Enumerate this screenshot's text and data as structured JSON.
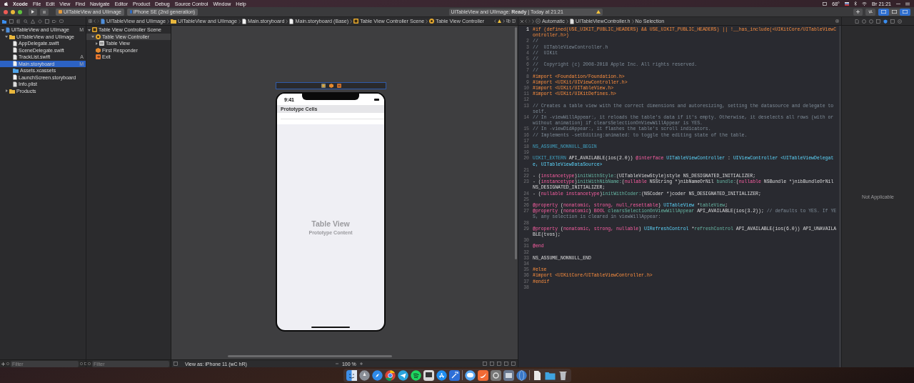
{
  "menu_bar": {
    "app": "Xcode",
    "menus": [
      "File",
      "Edit",
      "View",
      "Find",
      "Navigate",
      "Editor",
      "Product",
      "Debug",
      "Source Control",
      "Window",
      "Help"
    ],
    "temperature": "68°",
    "clock": "Вт 21:21"
  },
  "toolbar": {
    "scheme": "UITableView and UIImage",
    "device": "iPhone SE (2nd generation)",
    "activity": "UITableView and UIImage: **Ready** | Today at 21:21"
  },
  "navigator": {
    "items": [
      {
        "label": "UITableView and UIImage",
        "kind": "project",
        "status": "M",
        "selected": false,
        "expanded": true,
        "children": [
          {
            "label": "UITableView and UIImage",
            "kind": "folder",
            "selected": false,
            "expanded": true,
            "children": [
              {
                "label": "AppDelegate.swift",
                "kind": "swift",
                "selected": false
              },
              {
                "label": "SceneDelegate.swift",
                "kind": "swift",
                "selected": false
              },
              {
                "label": "TrackList.swift",
                "kind": "swift",
                "status": "A",
                "selected": false
              },
              {
                "label": "Main.storyboard",
                "kind": "storyboard",
                "status": "M",
                "selected": true
              },
              {
                "label": "Assets.xcassets",
                "kind": "assets",
                "selected": false
              },
              {
                "label": "LaunchScreen.storyboard",
                "kind": "storyboard",
                "selected": false
              },
              {
                "label": "Info.plist",
                "kind": "plist",
                "selected": false
              }
            ]
          },
          {
            "label": "Products",
            "kind": "folder",
            "selected": false,
            "expanded": false
          }
        ]
      }
    ],
    "filter": {
      "placeholder": "Filter"
    }
  },
  "storyboard_jump_bar": [
    {
      "label": "UITableView and UIImage",
      "kind": "project"
    },
    {
      "label": "UITableView and UIImage",
      "kind": "folder"
    },
    {
      "label": "Main.storyboard",
      "kind": "storyboard"
    },
    {
      "label": "Main.storyboard (Base)",
      "kind": "storyboard"
    },
    {
      "label": "Table View Controller Scene",
      "kind": "scene"
    },
    {
      "label": "Table View Controller",
      "kind": "controller"
    }
  ],
  "outline": {
    "items": [
      {
        "label": "Table View Controller Scene",
        "kind": "scene",
        "selected": false,
        "expanded": true,
        "children": [
          {
            "label": "Table View Controller",
            "kind": "controller",
            "selected": true,
            "expanded": true,
            "children": [
              {
                "label": "Table View",
                "kind": "tableview",
                "selected": false,
                "expanded": false
              }
            ]
          },
          {
            "label": "First Responder",
            "kind": "responder",
            "selected": false
          },
          {
            "label": "Exit",
            "kind": "exit",
            "selected": false
          }
        ]
      }
    ],
    "filter": {
      "placeholder": "Filter"
    }
  },
  "canvas": {
    "status_time": "9:41",
    "section_header": "Prototype Cells",
    "placeholder_title": "Table View",
    "placeholder_subtitle": "Prototype Content",
    "view_as": "View as: iPhone 11 (wC hR)",
    "zoom": "100 %"
  },
  "editor": {
    "jump_bar": [
      {
        "label": "Automatic",
        "kind": "automatic"
      },
      {
        "label": "UITableViewController.h",
        "kind": "header"
      },
      {
        "label": "No Selection",
        "kind": "none"
      }
    ],
    "lines": [
      {
        "number": "1",
        "segments": [
          {
            "text": "#if (defined(USE_UIKIT_PUBLIC_HEADERS) && USE_UIKIT_PUBLIC_HEADERS) || !__has_include(<UIKitCore/UITableViewController.h>)",
            "kind": "preproc"
          }
        ]
      },
      {
        "number": "2",
        "segments": [
          {
            "text": "//",
            "kind": "comment"
          }
        ]
      },
      {
        "number": "3",
        "segments": [
          {
            "text": "//  UITableViewController.h",
            "kind": "comment"
          }
        ]
      },
      {
        "number": "4",
        "segments": [
          {
            "text": "//  UIKit",
            "kind": "comment"
          }
        ]
      },
      {
        "number": "5",
        "segments": [
          {
            "text": "//",
            "kind": "comment"
          }
        ]
      },
      {
        "number": "6",
        "segments": [
          {
            "text": "//  Copyright (c) 2008-2018 Apple Inc. All rights reserved.",
            "kind": "comment"
          }
        ]
      },
      {
        "number": "7",
        "segments": [
          {
            "text": "//",
            "kind": "comment"
          }
        ]
      },
      {
        "number": "8",
        "segments": [
          {
            "text": "#import <Foundation/Foundation.h>",
            "kind": "preproc"
          }
        ]
      },
      {
        "number": "9",
        "segments": [
          {
            "text": "#import <UIKit/UIViewController.h>",
            "kind": "preproc"
          }
        ]
      },
      {
        "number": "10",
        "segments": [
          {
            "text": "#import <UIKit/UITableView.h>",
            "kind": "preproc"
          }
        ]
      },
      {
        "number": "11",
        "segments": [
          {
            "text": "#import <UIKit/UIKitDefines.h>",
            "kind": "preproc"
          }
        ]
      },
      {
        "number": "12"
      },
      {
        "number": "13",
        "segments": [
          {
            "text": "// Creates a table view with the correct dimensions and autoresizing, setting the datasource and delegate to self.",
            "kind": "comment"
          }
        ]
      },
      {
        "number": "14",
        "segments": [
          {
            "text": "// In -viewWillAppear:, it reloads the table's data if it's empty. Otherwise, it deselects all rows (with or without animation) if clearsSelectionOnViewWillAppear is YES.",
            "kind": "comment"
          }
        ]
      },
      {
        "number": "15",
        "segments": [
          {
            "text": "// In -viewDidAppear:, it flashes the table's scroll indicators.",
            "kind": "comment"
          }
        ]
      },
      {
        "number": "16",
        "segments": [
          {
            "text": "// Implements -setEditing:animated: to toggle the editing state of the table.",
            "kind": "comment"
          }
        ]
      },
      {
        "number": "17"
      },
      {
        "number": "18",
        "segments": [
          {
            "text": "NS_ASSUME_NONNULL_BEGIN",
            "kind": "macro"
          }
        ]
      },
      {
        "number": "19"
      },
      {
        "number": "20",
        "segments": [
          {
            "text": "UIKIT_EXTERN",
            "kind": "macro"
          },
          {
            "text": " API_AVAILABLE(ios(2.0)) ",
            "kind": "plain"
          },
          {
            "text": "@interface",
            "kind": "keyword"
          },
          {
            "text": " UITableViewController",
            "kind": "type"
          },
          {
            "text": " : ",
            "kind": "plain"
          },
          {
            "text": "UIViewController",
            "kind": "type"
          },
          {
            "text": " <UITableViewDelegate, UITableViewDataSource>",
            "kind": "type"
          }
        ]
      },
      {
        "number": "21"
      },
      {
        "number": "22",
        "segments": [
          {
            "text": "- (",
            "kind": "plain"
          },
          {
            "text": "instancetype",
            "kind": "keyword"
          },
          {
            "text": ")",
            "kind": "plain"
          },
          {
            "text": "initWithStyle:",
            "kind": "method"
          },
          {
            "text": "(UITableViewStyle)style NS_DESIGNATED_INITIALIZER;",
            "kind": "plain"
          }
        ]
      },
      {
        "number": "23",
        "segments": [
          {
            "text": "- (",
            "kind": "plain"
          },
          {
            "text": "instancetype",
            "kind": "keyword"
          },
          {
            "text": ")",
            "kind": "plain"
          },
          {
            "text": "initWithNibName:",
            "kind": "method"
          },
          {
            "text": "(",
            "kind": "plain"
          },
          {
            "text": "nullable",
            "kind": "keyword"
          },
          {
            "text": " NSString *)nibNameOrNil ",
            "kind": "plain"
          },
          {
            "text": "bundle:",
            "kind": "method"
          },
          {
            "text": "(",
            "kind": "plain"
          },
          {
            "text": "nullable",
            "kind": "keyword"
          },
          {
            "text": " NSBundle *)nibBundleOrNil NS_DESIGNATED_INITIALIZER;",
            "kind": "plain"
          }
        ]
      },
      {
        "number": "24",
        "segments": [
          {
            "text": "- (",
            "kind": "plain"
          },
          {
            "text": "nullable instancetype",
            "kind": "keyword"
          },
          {
            "text": ")",
            "kind": "plain"
          },
          {
            "text": "initWithCoder:",
            "kind": "method"
          },
          {
            "text": "(NSCoder *)coder NS_DESIGNATED_INITIALIZER;",
            "kind": "plain"
          }
        ]
      },
      {
        "number": "25"
      },
      {
        "number": "26",
        "segments": [
          {
            "text": "@property",
            "kind": "keyword"
          },
          {
            "text": " (",
            "kind": "plain"
          },
          {
            "text": "nonatomic, strong, null_resettable",
            "kind": "keyword"
          },
          {
            "text": ") ",
            "kind": "plain"
          },
          {
            "text": "UITableView",
            "kind": "type"
          },
          {
            "text": " *",
            "kind": "plain"
          },
          {
            "text": "tableView",
            "kind": "method"
          },
          {
            "text": ";",
            "kind": "plain"
          }
        ]
      },
      {
        "number": "27",
        "segments": [
          {
            "text": "@property",
            "kind": "keyword"
          },
          {
            "text": " (",
            "kind": "plain"
          },
          {
            "text": "nonatomic",
            "kind": "keyword"
          },
          {
            "text": ") ",
            "kind": "plain"
          },
          {
            "text": "BOOL",
            "kind": "keyword"
          },
          {
            "text": " clearsSelectionOnViewWillAppear",
            "kind": "method"
          },
          {
            "text": " API_AVAILABLE(ios(3.2)); ",
            "kind": "plain"
          },
          {
            "text": "// defaults to YES. If YES, any selection is cleared in viewWillAppear:",
            "kind": "comment"
          }
        ]
      },
      {
        "number": "28"
      },
      {
        "number": "29",
        "segments": [
          {
            "text": "@property",
            "kind": "keyword"
          },
          {
            "text": " (",
            "kind": "plain"
          },
          {
            "text": "nonatomic, strong, nullable",
            "kind": "keyword"
          },
          {
            "text": ") ",
            "kind": "plain"
          },
          {
            "text": "UIRefreshControl",
            "kind": "type"
          },
          {
            "text": " *",
            "kind": "plain"
          },
          {
            "text": "refreshControl",
            "kind": "method"
          },
          {
            "text": " API_AVAILABLE(ios(6.0)) API_UNAVAILABLE(tvos);",
            "kind": "plain"
          }
        ]
      },
      {
        "number": "30"
      },
      {
        "number": "31",
        "segments": [
          {
            "text": "@end",
            "kind": "keyword"
          }
        ]
      },
      {
        "number": "32"
      },
      {
        "number": "33",
        "segments": [
          {
            "text": "NS_ASSUME_NONNULL_END",
            "kind": "plain"
          }
        ]
      },
      {
        "number": "34"
      },
      {
        "number": "35",
        "segments": [
          {
            "text": "#else",
            "kind": "preproc"
          }
        ]
      },
      {
        "number": "36",
        "segments": [
          {
            "text": "#import <UIKitCore/UITableViewController.h>",
            "kind": "preproc"
          }
        ]
      },
      {
        "number": "37",
        "segments": [
          {
            "text": "#endif",
            "kind": "preproc"
          }
        ]
      },
      {
        "number": "38"
      }
    ]
  },
  "inspector": {
    "message": "Not Applicable"
  }
}
